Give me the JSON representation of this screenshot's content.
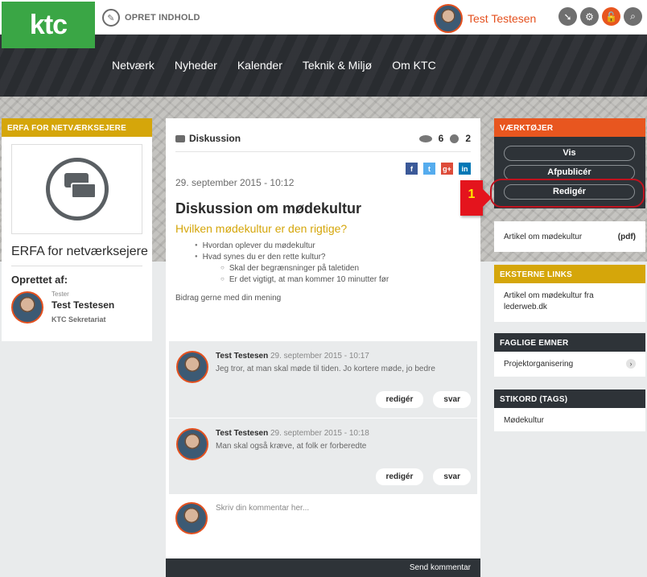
{
  "header": {
    "logo": "ktc",
    "create_label": "OPRET INDHOLD",
    "user_name": "Test Testesen"
  },
  "nav": {
    "items": [
      "Netværk",
      "Nyheder",
      "Kalender",
      "Teknik & Miljø",
      "Om KTC"
    ]
  },
  "left": {
    "header": "ERFA FOR NETVÆRKSEJERE",
    "title": "ERFA for netværksejere",
    "created_label": "Oprettet af:",
    "creator_role": "Tester",
    "creator_name": "Test Testesen",
    "creator_org": "KTC Sekretariat"
  },
  "center": {
    "type_label": "Diskussion",
    "views": "6",
    "comments_count": "2",
    "share": {
      "fb": "f",
      "tw": "t",
      "gp": "g+",
      "li": "in"
    },
    "date": "29. september 2015 - 10:12",
    "title": "Diskussion om mødekultur",
    "subtitle": "Hvilken mødekultur er den rigtige?",
    "bullets": [
      "Hvordan oplever du mødekultur",
      "Hvad synes du er den rette kultur?"
    ],
    "sub_bullets": [
      "Skal der begrænsninger på taletiden",
      "Er det vigtigt, at man kommer 10 minutter før"
    ],
    "contribute": "Bidrag gerne med din mening",
    "comments": [
      {
        "author": "Test Testesen",
        "date": "29. september 2015 - 10:17",
        "text": "Jeg tror, at man skal møde til tiden. Jo kortere møde, jo bedre",
        "edit": "redigér",
        "reply": "svar"
      },
      {
        "author": "Test Testesen",
        "date": "29. september 2015 - 10:18",
        "text": "Man skal også kræve, at folk er forberedte",
        "edit": "redigér",
        "reply": "svar"
      }
    ],
    "comment_placeholder": "Skriv din kommentar her...",
    "send_label": "Send kommentar"
  },
  "right": {
    "tools_header": "VÆRKTØJER",
    "tools": [
      "Vis",
      "Afpublicér",
      "Redigér"
    ],
    "article": "Artikel om mødekultur",
    "article_type": "(pdf)",
    "ext_header": "EKSTERNE LINKS",
    "ext_link": "Artikel om mødekultur fra lederweb.dk",
    "fag_header": "FAGLIGE EMNER",
    "fag_item": "Projektorganisering",
    "tags_header": "STIKORD (TAGS)",
    "tag_item": "Mødekultur"
  },
  "annotation": {
    "marker": "1"
  },
  "colors": {
    "brand_green": "#3aa645",
    "accent_orange": "#e8561f",
    "gold": "#d5a60a",
    "dark": "#2e3338",
    "marker_red": "#e4141d"
  }
}
